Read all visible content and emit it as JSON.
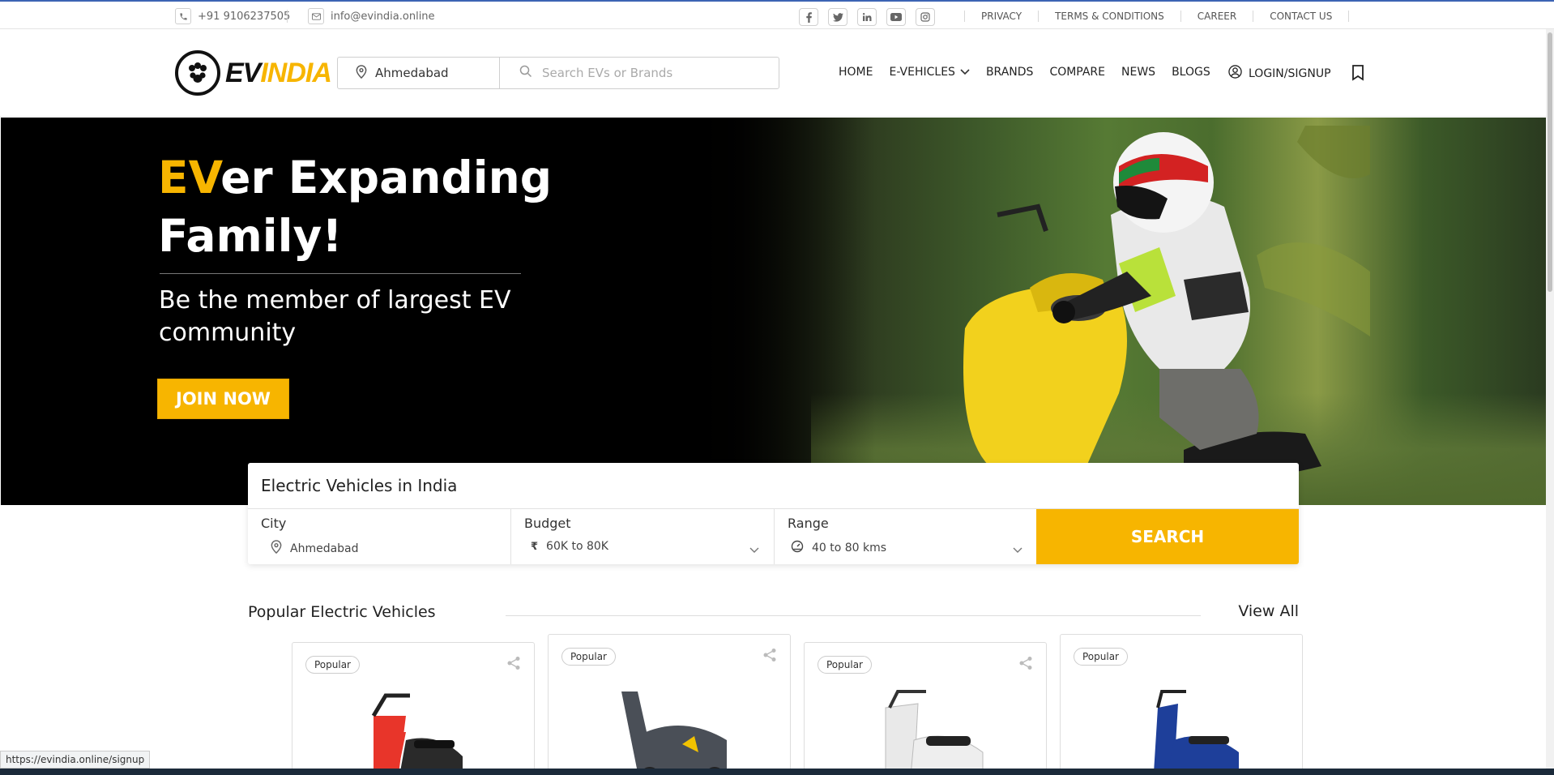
{
  "topbar": {
    "phone": "+91 9106237505",
    "email": "info@evindia.online",
    "social_icons": [
      "facebook-icon",
      "twitter-icon",
      "linkedin-icon",
      "youtube-icon",
      "instagram-icon"
    ],
    "links": [
      "PRIVACY",
      "TERMS & CONDITIONS",
      "CAREER",
      "CONTACT US"
    ]
  },
  "header": {
    "logo_ev": "EV",
    "logo_india": "INDIA",
    "city": "Ahmedabad",
    "search_placeholder": "Search EVs or Brands",
    "nav": [
      "HOME",
      "E-VEHICLES",
      "BRANDS",
      "COMPARE",
      "NEWS",
      "BLOGS"
    ],
    "login": "LOGIN/SIGNUP"
  },
  "hero": {
    "headline_accent": "EV",
    "headline_rest": "er Expanding Family!",
    "subheadline": "Be the member of largest EV community",
    "cta": "JOIN NOW"
  },
  "finder": {
    "title": "Electric Vehicles in India",
    "city_label": "City",
    "city_value": "Ahmedabad",
    "budget_label": "Budget",
    "budget_value": "60K to 80K",
    "range_label": "Range",
    "range_value": "40 to 80 kms",
    "search_label": "SEARCH"
  },
  "popular": {
    "title": "Popular Electric Vehicles",
    "view_all": "View All",
    "cards": [
      {
        "badge": "Popular",
        "color": "#e8352a"
      },
      {
        "badge": "Popular",
        "color": "#4a4f57"
      },
      {
        "badge": "Popular",
        "color": "#e9e9e9"
      },
      {
        "badge": "Popular",
        "color": "#1e3f9a"
      }
    ]
  },
  "status_url": "https://evindia.online/signup",
  "colors": {
    "accent": "#f7b500",
    "dark": "#000000"
  }
}
